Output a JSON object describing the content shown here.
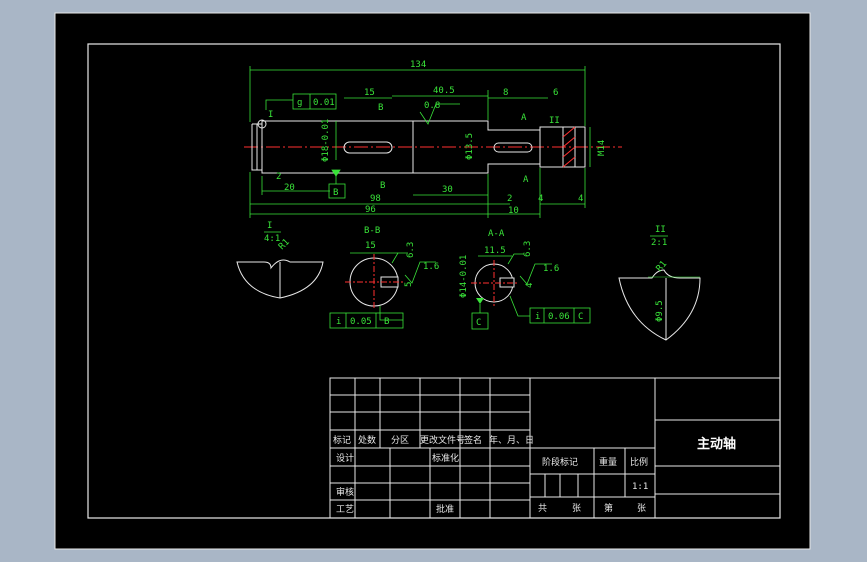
{
  "drawing": {
    "overall_length": "134",
    "dims_top": [
      "15",
      "40.5",
      "8",
      "6"
    ],
    "dims_bottom": [
      "20",
      "30",
      "98",
      "96",
      "2",
      "10",
      "4",
      "4",
      "2"
    ],
    "diameters": [
      "Φ18-0.01",
      "Φ13.5",
      "M14"
    ],
    "roughness": [
      "0.8",
      "6.3",
      "1.6",
      "6.3",
      "1.6"
    ],
    "tolerances": {
      "main": {
        "symbol": "g",
        "value": "0.01"
      },
      "bb": {
        "symbol": "i",
        "value": "0.05",
        "datum": "B"
      },
      "aa": {
        "symbol": "i",
        "value": "0.06",
        "datum": "C"
      }
    },
    "datums": [
      "B",
      "C"
    ],
    "section_marks": [
      "B",
      "B",
      "A",
      "A"
    ],
    "detail_marks": [
      "I",
      "II"
    ],
    "detail_labels": [
      "I",
      "4:1",
      "II",
      "2:1"
    ],
    "detail_dims": [
      "R1",
      "R1",
      "Φ9.5"
    ],
    "section_titles": [
      "B-B",
      "A-A"
    ],
    "section_dims": [
      "15",
      "5",
      "11.5",
      "4",
      "Φ14-0.01"
    ]
  },
  "title_block": {
    "headers": [
      "标记",
      "处数",
      "分区",
      "更改文件号",
      "签名",
      "年、月、日"
    ],
    "rows": [
      "设计",
      "标准化",
      "审核",
      "工艺",
      "批准"
    ],
    "stage": "阶段标记",
    "weight": "重量",
    "scale_label": "比例",
    "scale": "1:1",
    "sheet": [
      "共",
      "张",
      "第",
      "张"
    ],
    "part_name": "主动轴"
  }
}
